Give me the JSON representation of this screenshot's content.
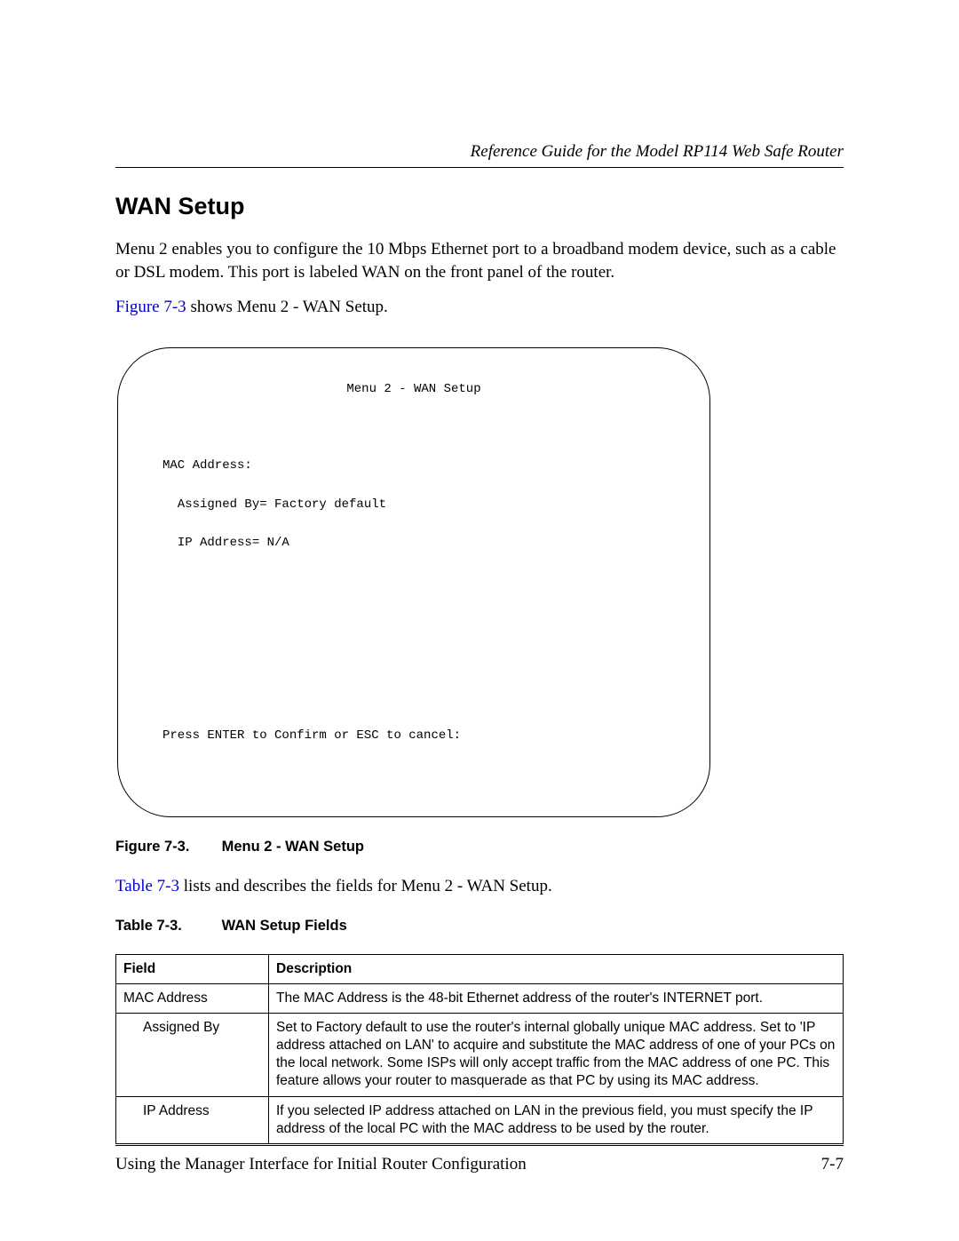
{
  "header": {
    "doc_title": "Reference Guide for the Model RP114 Web Safe Router"
  },
  "section": {
    "heading": "WAN Setup",
    "para1": "Menu 2 enables you to configure the 10 Mbps Ethernet port to a broadband modem device, such as a cable or DSL modem. This port is labeled WAN on the front panel of the router.",
    "para2_link": "Figure 7-3",
    "para2_rest": " shows Menu 2 - WAN Setup."
  },
  "terminal": {
    "title": "Menu 2 - WAN Setup",
    "line_mac": "MAC Address:",
    "line_assigned": "  Assigned By= Factory default",
    "line_ip": "  IP Address= N/A",
    "prompt": "Press ENTER to Confirm or ESC to cancel:"
  },
  "figure": {
    "label": "Figure 7-3.",
    "title": "Menu 2 - WAN Setup"
  },
  "para3_link": "Table 7-3",
  "para3_rest": " lists and describes the fields for Menu 2 - WAN Setup.",
  "table": {
    "label": "Table 7-3.",
    "title": "WAN Setup Fields",
    "head_field": "Field",
    "head_desc": "Description",
    "rows": [
      {
        "field": "MAC Address",
        "indent": false,
        "desc": "The MAC Address is the 48-bit Ethernet address of the router's INTERNET port."
      },
      {
        "field": "Assigned By",
        "indent": true,
        "desc": "Set to Factory default to use the router's internal globally unique MAC address. Set to 'IP address attached on LAN' to acquire and substitute the MAC address of one of your PCs on the local network. Some ISPs will only accept traffic from the MAC address of one PC. This feature allows your router to masquerade as that PC by using its MAC address."
      },
      {
        "field": "IP Address",
        "indent": true,
        "desc": "If you selected IP address attached on LAN in the previous field, you must specify the IP address of the local PC with the MAC address to be used by the router."
      }
    ]
  },
  "footer": {
    "left": "Using the Manager Interface for Initial Router Configuration",
    "right": "7-7"
  }
}
